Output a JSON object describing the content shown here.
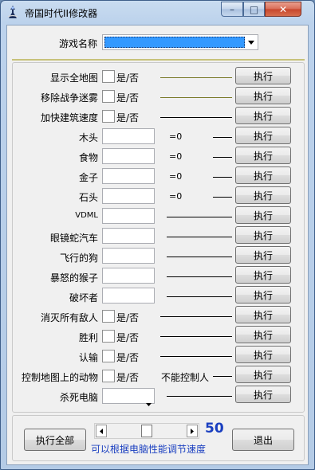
{
  "window": {
    "title": "帝国时代II修改器",
    "minimize_glyph": "–",
    "maximize_glyph": "□",
    "close_glyph": "✕"
  },
  "game_select": {
    "label": "游戏名称",
    "value": ""
  },
  "toggles": [
    {
      "label": "显示全地图",
      "check_text": "是/否",
      "button": "执行"
    },
    {
      "label": "移除战争迷雾",
      "check_text": "是/否",
      "button": "执行"
    },
    {
      "label": "加快建筑速度",
      "check_text": "是/否",
      "button": "执行"
    }
  ],
  "resources": [
    {
      "label": "木头",
      "value": "",
      "eq": "=0",
      "button": "执行"
    },
    {
      "label": "食物",
      "value": "",
      "eq": "=0",
      "button": "执行"
    },
    {
      "label": "金子",
      "value": "",
      "eq": "=0",
      "button": "执行"
    },
    {
      "label": "石头",
      "value": "",
      "eq": "=0",
      "button": "执行"
    }
  ],
  "units": [
    {
      "label": "VDML",
      "value": "",
      "button": "执行"
    },
    {
      "label": "眼镜蛇汽车",
      "value": "",
      "button": "执行"
    },
    {
      "label": "飞行的狗",
      "value": "",
      "button": "执行"
    },
    {
      "label": "暴怒的猴子",
      "value": "",
      "button": "执行"
    },
    {
      "label": "破坏者",
      "value": "",
      "button": "执行"
    }
  ],
  "actions": [
    {
      "label": "消灭所有敌人",
      "check_text": "是/否",
      "button": "执行"
    },
    {
      "label": "胜利",
      "check_text": "是/否",
      "button": "执行"
    },
    {
      "label": "认输",
      "check_text": "是/否",
      "button": "执行"
    }
  ],
  "control_row": {
    "label": "控制地图上的动物",
    "check_text": "是/否",
    "note": "不能控制人",
    "button": "执行"
  },
  "kill_row": {
    "label": "杀死电脑",
    "value": "",
    "button": "执行"
  },
  "bottom": {
    "execute_all": "执行全部",
    "speed_value": "50",
    "speed_level": 0.5,
    "speed_hint": "可以根据电脑性能调节速度",
    "exit": "退出"
  },
  "colors": {
    "selection_blue": "#3399ff",
    "speed_text": "#1a3fc0",
    "title_bar": "#c9dcf0"
  }
}
